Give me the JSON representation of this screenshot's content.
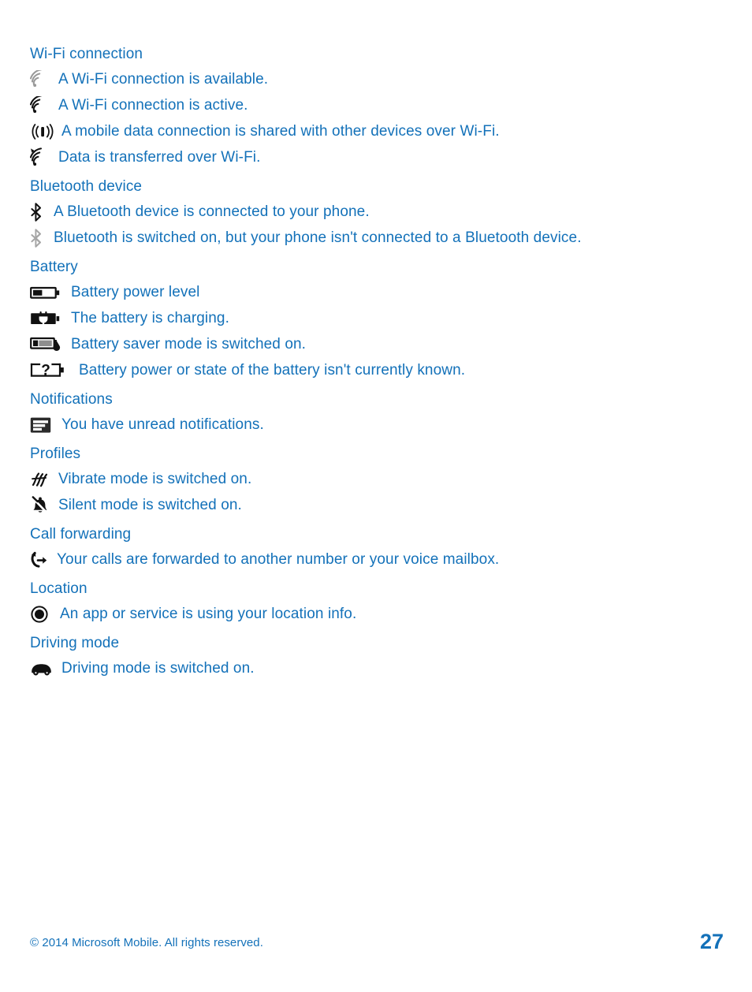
{
  "document": {
    "type": "user-guide-page",
    "accent_color": "#1371b9",
    "icon_active_color": "#1a1a1a",
    "icon_inactive_color": "#9a9a9a"
  },
  "sections": [
    {
      "header": "Wi-Fi connection",
      "items": [
        {
          "icon": "wifi-available-icon",
          "label": "A Wi-Fi connection is available."
        },
        {
          "icon": "wifi-active-icon",
          "label": "A Wi-Fi connection is active."
        },
        {
          "icon": "mobile-hotspot-icon",
          "label": "A mobile data connection is shared with other devices over Wi-Fi."
        },
        {
          "icon": "wifi-data-transfer-icon",
          "label": "Data is transferred over Wi-Fi."
        }
      ]
    },
    {
      "header": "Bluetooth device",
      "items": [
        {
          "icon": "bluetooth-connected-icon",
          "label": "A Bluetooth device is connected to your phone."
        },
        {
          "icon": "bluetooth-on-icon",
          "label": "Bluetooth is switched on, but your phone isn't connected to a Bluetooth device."
        }
      ]
    },
    {
      "header": "Battery",
      "items": [
        {
          "icon": "battery-level-icon",
          "label": "Battery power level"
        },
        {
          "icon": "battery-charging-icon",
          "label": "The battery is charging."
        },
        {
          "icon": "battery-saver-icon",
          "label": "Battery saver mode is switched on."
        },
        {
          "icon": "battery-unknown-icon",
          "label": "Battery power or state of the battery isn't currently known."
        }
      ]
    },
    {
      "header": "Notifications",
      "items": [
        {
          "icon": "notifications-unread-icon",
          "label": "You have unread notifications."
        }
      ]
    },
    {
      "header": "Profiles",
      "items": [
        {
          "icon": "vibrate-icon",
          "label": "Vibrate mode is switched on."
        },
        {
          "icon": "silent-bell-icon",
          "label": "Silent mode is switched on."
        }
      ]
    },
    {
      "header": "Call forwarding",
      "items": [
        {
          "icon": "call-forwarding-icon",
          "label": "Your calls are forwarded to another number or your voice mailbox."
        }
      ]
    },
    {
      "header": "Location",
      "items": [
        {
          "icon": "location-icon",
          "label": "An app or service is using your location info."
        }
      ]
    },
    {
      "header": "Driving mode",
      "items": [
        {
          "icon": "driving-mode-car-icon",
          "label": "Driving mode is switched on."
        }
      ]
    }
  ],
  "footer": {
    "copyright": "© 2014 Microsoft Mobile. All rights reserved.",
    "page_number": "27"
  }
}
